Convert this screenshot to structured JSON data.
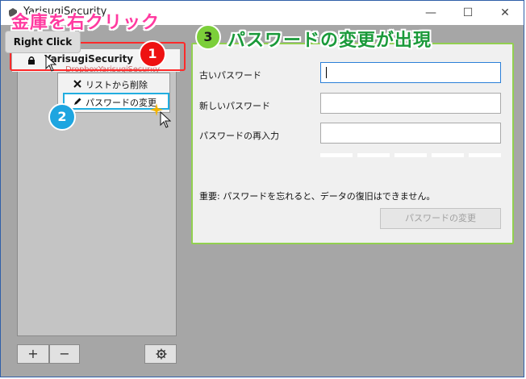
{
  "window": {
    "title": "YarisugiSecurity",
    "minimize": "—",
    "maximize": "☐",
    "close": "✕"
  },
  "annotations": {
    "step1_title": "金庫を右クリック",
    "step3_title": "パスワードの変更が出現",
    "tooltip": "Right Click",
    "badge1": "1",
    "badge2": "2",
    "badge3": "3"
  },
  "sidebar": {
    "vault": {
      "name": "YarisugiSecurity",
      "path": "DropboxYarisugiSecurity"
    },
    "context_menu": [
      {
        "label": "リストから削除",
        "icon": "close-icon"
      },
      {
        "label": "パスワードの変更",
        "icon": "pencil-icon",
        "highlighted": true
      }
    ],
    "add_label": "+",
    "remove_label": "−",
    "settings_icon": "gear-icon"
  },
  "panel": {
    "old_password_label": "古いパスワード",
    "new_password_label": "新しいパスワード",
    "reenter_label": "パスワードの再入力",
    "old_password_value": "",
    "new_password_value": "",
    "reenter_value": "",
    "warning": "重要: パスワードを忘れると、データの復旧はできません。",
    "change_button": "パスワードの変更"
  },
  "colors": {
    "annotation_pink": "#ff3aa0",
    "annotation_green": "#1a9a3a",
    "badge_red": "#ee1111",
    "badge_blue": "#1ea5e0",
    "badge_green": "#7ccf3a",
    "panel_border": "#92d050",
    "highlight_blue": "#22aee0"
  }
}
